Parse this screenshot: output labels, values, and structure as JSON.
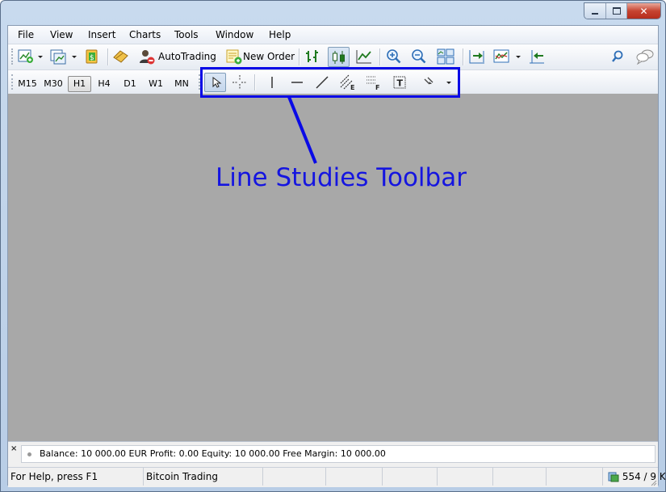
{
  "menu": [
    "File",
    "View",
    "Insert",
    "Charts",
    "Tools",
    "Window",
    "Help"
  ],
  "toolbar": {
    "autotrading_label": "AutoTrading",
    "new_order_label": "New Order"
  },
  "timeframes": [
    "M15",
    "M30",
    "H1",
    "H4",
    "D1",
    "W1",
    "MN"
  ],
  "selected_timeframe": "H1",
  "annotation": {
    "label": "Line Studies Toolbar"
  },
  "terminal": {
    "close_glyph": "×",
    "balance_text": "Balance: 10 000.00 EUR  Profit: 0.00  Equity: 10 000.00  Free Margin: 10 000.00"
  },
  "status": {
    "help": "For Help, press F1",
    "profile": "Bitcoin Trading",
    "traffic": "554 / 9 K"
  },
  "colors": {
    "annotation": "#1515e0",
    "chart_bg": "#a8a8a8"
  }
}
